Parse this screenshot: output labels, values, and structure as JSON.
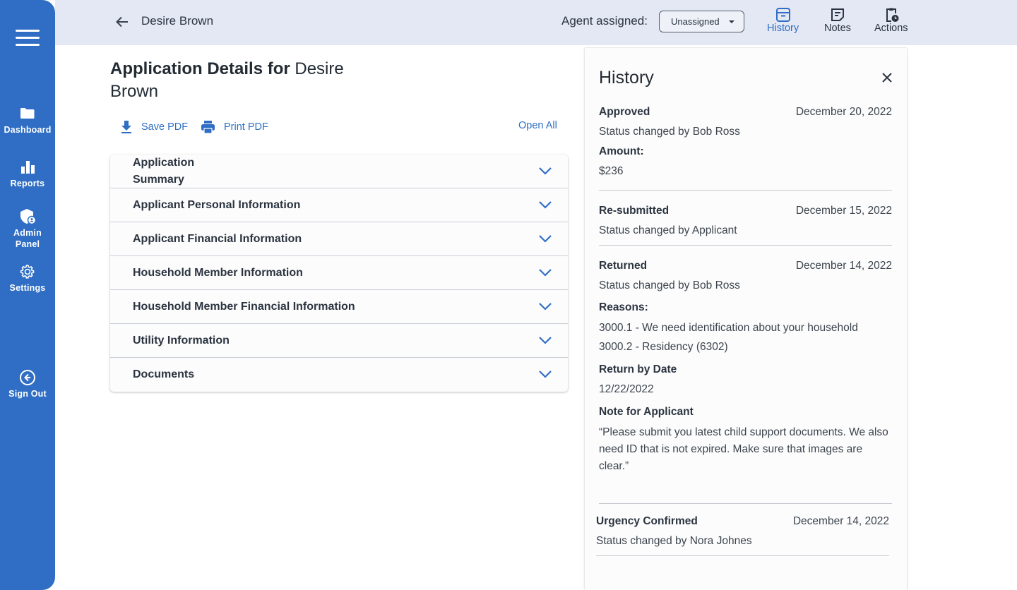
{
  "sidebar": {
    "menu_icon": "hamburger-icon",
    "items": [
      {
        "label": "Dashboard",
        "icon": "folder-icon"
      },
      {
        "label": "Reports",
        "icon": "bar-chart-icon"
      },
      {
        "label": "Admin Panel",
        "icon": "shield-user-icon"
      },
      {
        "label": "Settings",
        "icon": "gear-icon"
      },
      {
        "label": "Sign Out",
        "icon": "sign-out-icon"
      }
    ],
    "color": "#2f6ec4"
  },
  "topbar": {
    "applicant_name": "Desire Brown",
    "agent_label": "Agent assigned:",
    "agent_value": "Unassigned",
    "actions": [
      {
        "label": "History",
        "icon": "archive-box-icon",
        "active": true
      },
      {
        "label": "Notes",
        "icon": "note-icon",
        "active": false
      },
      {
        "label": "Actions",
        "icon": "clipboard-clock-icon",
        "active": false
      }
    ]
  },
  "main": {
    "title_prefix": "Application Details for",
    "title_name": "Desire Brown",
    "save_pdf": "Save PDF",
    "print_pdf": "Print PDF",
    "open_all": "Open All",
    "sections": [
      "Application Summary",
      "Applicant Personal Information",
      "Applicant Financial Information",
      "Household Member Information",
      "Household Member Financial Information",
      "Utility Information",
      "Documents"
    ]
  },
  "history": {
    "title": "History",
    "entries": [
      {
        "status": "Approved",
        "date": "December 20, 2022",
        "by": "Status changed by Bob Ross",
        "amount_label": "Amount:",
        "amount": "$236"
      },
      {
        "status": "Re-submitted",
        "date": "December 15, 2022",
        "by": "Status changed by Applicant"
      },
      {
        "status": "Returned",
        "date": "December 14, 2022",
        "by": "Status changed by Bob Ross",
        "reasons_label": "Reasons:",
        "reasons": [
          "3000.1 - We need identification about your household",
          "3000.2 - Residency (6302)"
        ],
        "return_label": "Return by Date",
        "return_date": "12/22/2022",
        "note_label": "Note for Applicant",
        "note": "“Please submit you latest child support documents. We also need ID that is not expired. Make sure that images are clear.”"
      },
      {
        "status": "Urgency Confirmed",
        "date": "December 14, 2022",
        "by": "Status changed by Nora Johnes"
      }
    ]
  },
  "colors": {
    "accent": "#2f6ec4",
    "topbar": "#e3e8f4",
    "text": "#222b33"
  }
}
